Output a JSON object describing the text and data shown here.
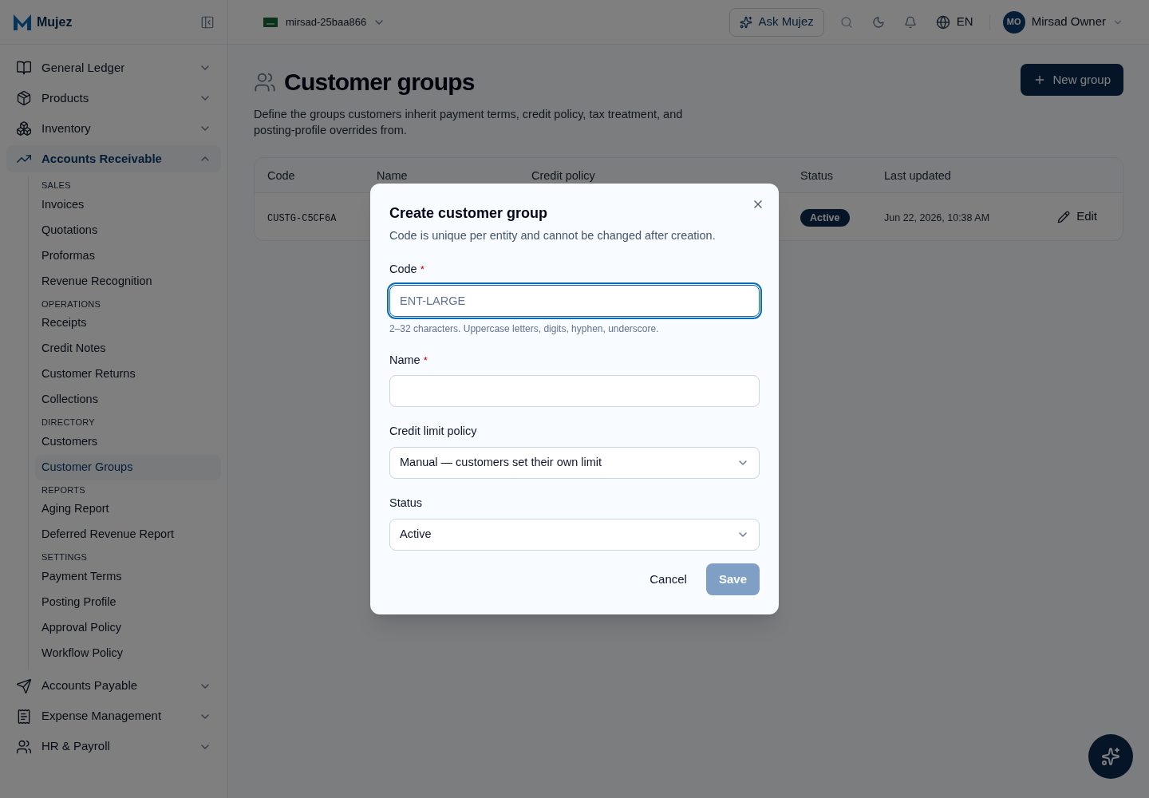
{
  "brand": "Mujez",
  "topbar": {
    "organization": "mirsad-25baa866",
    "ask_button": "Ask Mujez",
    "language": "EN",
    "user": {
      "initials": "MO",
      "name": "Mirsad Owner"
    }
  },
  "sidebar": {
    "groups": [
      {
        "label": "General Ledger",
        "expanded": false,
        "selected": false
      },
      {
        "label": "Products",
        "expanded": false,
        "selected": false
      },
      {
        "label": "Inventory",
        "expanded": false,
        "selected": false
      },
      {
        "label": "Accounts Receivable",
        "expanded": true,
        "selected": true,
        "sections": [
          {
            "heading": "SALES",
            "items": [
              {
                "label": "Invoices",
                "selected": false
              },
              {
                "label": "Quotations",
                "selected": false
              },
              {
                "label": "Proformas",
                "selected": false
              },
              {
                "label": "Revenue Recognition",
                "selected": false
              }
            ]
          },
          {
            "heading": "OPERATIONS",
            "items": [
              {
                "label": "Receipts",
                "selected": false
              },
              {
                "label": "Credit Notes",
                "selected": false
              },
              {
                "label": "Customer Returns",
                "selected": false
              },
              {
                "label": "Collections",
                "selected": false
              }
            ]
          },
          {
            "heading": "DIRECTORY",
            "items": [
              {
                "label": "Customers",
                "selected": false
              },
              {
                "label": "Customer Groups",
                "selected": true
              }
            ]
          },
          {
            "heading": "REPORTS",
            "items": [
              {
                "label": "Aging Report",
                "selected": false
              },
              {
                "label": "Deferred Revenue Report",
                "selected": false
              }
            ]
          },
          {
            "heading": "SETTINGS",
            "items": [
              {
                "label": "Payment Terms",
                "selected": false
              },
              {
                "label": "Posting Profile",
                "selected": false
              },
              {
                "label": "Approval Policy",
                "selected": false
              },
              {
                "label": "Workflow Policy",
                "selected": false
              }
            ]
          }
        ]
      },
      {
        "label": "Accounts Payable",
        "expanded": false,
        "selected": false
      },
      {
        "label": "Expense Management",
        "expanded": false,
        "selected": false
      },
      {
        "label": "HR & Payroll",
        "expanded": false,
        "selected": false
      }
    ]
  },
  "page": {
    "title": "Customer groups",
    "description": "Define the groups customers inherit payment terms, credit policy, tax treatment, and posting-profile overrides from.",
    "new_button": "New group"
  },
  "table": {
    "columns": [
      "Code",
      "Name",
      "Credit policy",
      "Status",
      "Last updated"
    ],
    "rows": [
      {
        "code": "CUSTG-C5CF6A",
        "status": "Active",
        "last_updated": "Jun 22, 2026, 10:38 AM",
        "action": "Edit"
      }
    ]
  },
  "dialog": {
    "title": "Create customer group",
    "description": "Code is unique per entity and cannot be changed after creation.",
    "fields": [
      {
        "kind": "text",
        "label": "Code",
        "required_mark": "*",
        "placeholder": "ENT-LARGE",
        "focused": true,
        "helper": "2–32 characters. Uppercase letters, digits, hyphen, underscore."
      },
      {
        "kind": "text",
        "label": "Name",
        "required_mark": "*",
        "focused": false
      },
      {
        "kind": "select",
        "label": "Credit limit policy",
        "value": "Manual — customers set their own limit"
      },
      {
        "kind": "select",
        "label": "Status",
        "value": "Active"
      }
    ],
    "cancel": "Cancel",
    "save": {
      "label": "Save",
      "disabled": true
    }
  }
}
